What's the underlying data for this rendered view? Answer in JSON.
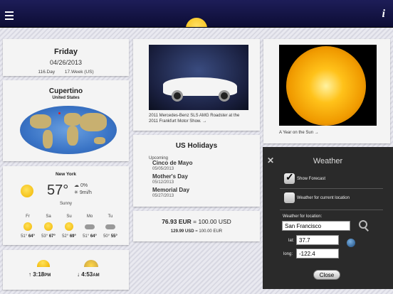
{
  "date_card": {
    "day": "Friday",
    "date": "04/26/2013",
    "day_of_year": "116.Day",
    "week": "17.Week (US)"
  },
  "location_card": {
    "city": "Cupertino",
    "country": "United States"
  },
  "weather_card": {
    "city": "New York",
    "temperature": "57°",
    "precipitation": "0%",
    "wind": "9mi/h",
    "condition": "Sunny",
    "forecast": [
      {
        "day": "Fr",
        "low": "51°",
        "high": "64°",
        "icon": "sun-icon"
      },
      {
        "day": "Sa",
        "low": "53°",
        "high": "67°",
        "icon": "sun-icon"
      },
      {
        "day": "Su",
        "low": "52°",
        "high": "69°",
        "icon": "sun-icon"
      },
      {
        "day": "Mo",
        "low": "51°",
        "high": "64°",
        "icon": "cloud-icon"
      },
      {
        "day": "Tu",
        "low": "50°",
        "high": "55°",
        "icon": "cloud-icon"
      }
    ]
  },
  "sun_times": {
    "sunset": "3:18",
    "sunset_suffix": "PM",
    "sunrise": "4:53",
    "sunrise_suffix": "AM"
  },
  "car_card": {
    "caption_line1": "2011 Mercedes-Benz SLS AMG Roadster at the",
    "caption_line2": "2011 Frankfurt Motor Show. →"
  },
  "sun_photo_card": {
    "caption": "A Year on the Sun →"
  },
  "holidays_card": {
    "title": "US Holidays",
    "upcoming_label": "Upcoming",
    "items": [
      {
        "name": "Cinco de Mayo",
        "date": "05/05/2013"
      },
      {
        "name": "Mother's Day",
        "date": "05/12/2013"
      },
      {
        "name": "Memorial Day",
        "date": "05/27/2013"
      }
    ]
  },
  "currency_card": {
    "line1_amount": "76.93 EUR",
    "line1_eq": "= 100.00 USD",
    "line2_amount": "129.99 USD",
    "line2_eq": "= 100.00 EUR"
  },
  "weather_panel": {
    "title": "Weather",
    "show_forecast_label": "Show Forecast",
    "show_forecast_checked": true,
    "current_location_label": "Weather for current location",
    "current_location_checked": false,
    "location_label": "Weather for location:",
    "location_value": "San Francisco",
    "lat_label": "lat:",
    "lat_value": "37.7",
    "long_label": "long:",
    "long_value": "-122.4",
    "close_label": "Close"
  },
  "header": {
    "info_label": "i"
  }
}
